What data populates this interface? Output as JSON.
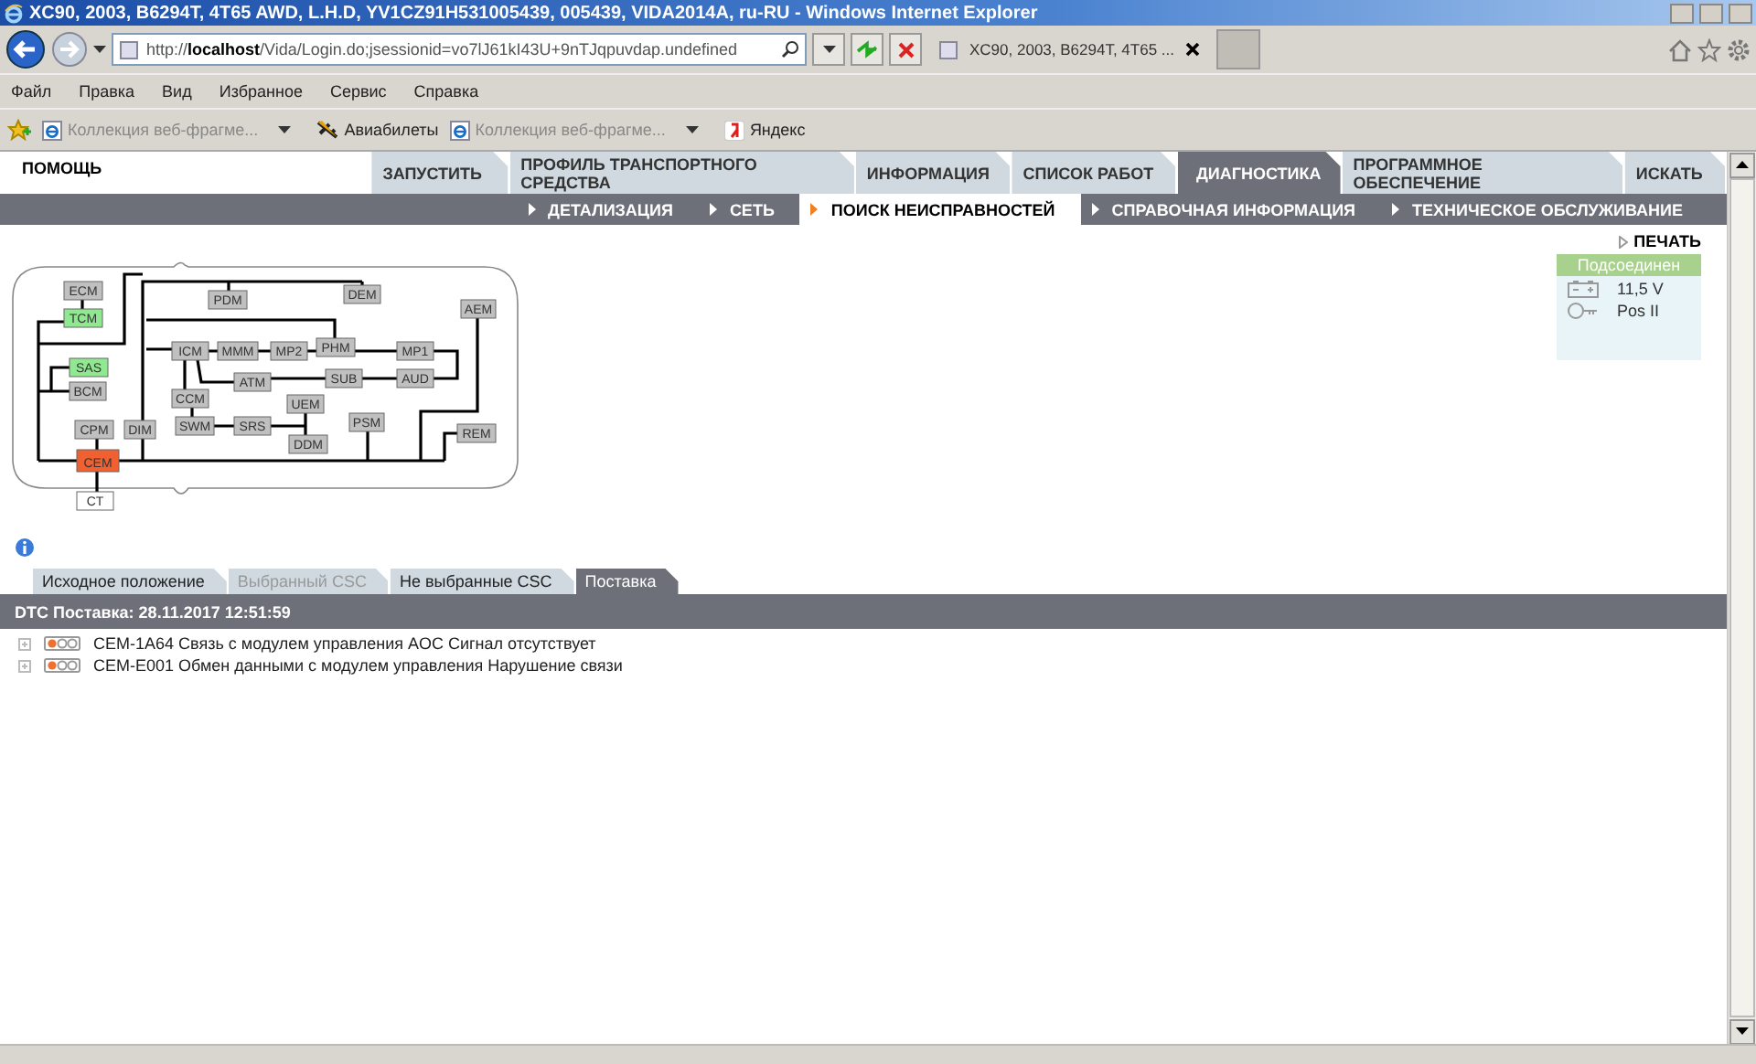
{
  "window": {
    "title": "XC90, 2003, B6294T, 4T65 AWD, L.H.D, YV1CZ91H531005439, 005439, VIDA2014A, ru-RU - Windows Internet Explorer"
  },
  "address_bar": {
    "url": "http://**localhost**/Vida/Login.do;jsessionid=vo7lJ61kI43U+9nTJqpuvdap.undefined"
  },
  "browser_tabs": [
    {
      "label": "XC90, 2003, B6294T, 4T65 ...",
      "selected": true
    }
  ],
  "menu": [
    "Файл",
    "Правка",
    "Вид",
    "Избранное",
    "Сервис",
    "Справка"
  ],
  "favorites": [
    {
      "label": "Коллекция веб-фрагме...",
      "kind": "gallery"
    },
    {
      "label": "Авиабилеты",
      "kind": "flight"
    },
    {
      "label": "Коллекция веб-фрагме...",
      "kind": "gallery"
    },
    {
      "label": "Яндекс",
      "kind": "yandex"
    }
  ],
  "app": {
    "help": "ПОМОЩЬ",
    "main_tabs": [
      {
        "label": "ЗАПУСТИТЬ",
        "selected": false
      },
      {
        "label": "ПРОФИЛЬ ТРАНСПОРТНОГО СРЕДСТВА",
        "selected": false
      },
      {
        "label": "ИНФОРМАЦИЯ",
        "selected": false
      },
      {
        "label": "СПИСОК РАБОТ",
        "selected": false
      },
      {
        "label": "ДИАГНОСТИКА",
        "selected": true
      },
      {
        "label": "ПРОГРАММНОЕ ОБЕСПЕЧЕНИЕ",
        "selected": false
      },
      {
        "label": "ИСКАТЬ",
        "selected": false
      }
    ],
    "sub_tabs": [
      {
        "label": "ДЕТАЛИЗАЦИЯ",
        "selected": false
      },
      {
        "label": "СЕТЬ",
        "selected": false
      },
      {
        "label": "ПОИСК НЕИСПРАВНОСТЕЙ",
        "selected": true
      },
      {
        "label": "СПРАВОЧНАЯ ИНФОРМАЦИЯ",
        "selected": false
      },
      {
        "label": "ТЕХНИЧЕСКОЕ ОБСЛУЖИВАНИЕ",
        "selected": false
      }
    ],
    "print": "ПЕЧАТЬ",
    "network": {
      "nodes": [
        {
          "label": "ECM",
          "color": "#c0c0c0"
        },
        {
          "label": "TCM",
          "color": "#90e890"
        },
        {
          "label": "SAS",
          "color": "#90e890"
        },
        {
          "label": "BCM",
          "color": "#c0c0c0"
        },
        {
          "label": "CPM",
          "color": "#c0c0c0"
        },
        {
          "label": "CEM",
          "color": "#f06030"
        },
        {
          "label": "CT",
          "color": "#ffffff"
        },
        {
          "label": "DIM",
          "color": "#c0c0c0"
        },
        {
          "label": "PDM",
          "color": "#c0c0c0"
        },
        {
          "label": "DEM",
          "color": "#c0c0c0"
        },
        {
          "label": "AEM",
          "color": "#c0c0c0"
        },
        {
          "label": "ICM",
          "color": "#c0c0c0"
        },
        {
          "label": "MMM",
          "color": "#c0c0c0"
        },
        {
          "label": "MP2",
          "color": "#c0c0c0"
        },
        {
          "label": "PHM",
          "color": "#c0c0c0"
        },
        {
          "label": "MP1",
          "color": "#c0c0c0"
        },
        {
          "label": "ATM",
          "color": "#c0c0c0"
        },
        {
          "label": "SUB",
          "color": "#c0c0c0"
        },
        {
          "label": "AUD",
          "color": "#c0c0c0"
        },
        {
          "label": "CCM",
          "color": "#c0c0c0"
        },
        {
          "label": "UEM",
          "color": "#c0c0c0"
        },
        {
          "label": "SWM",
          "color": "#c0c0c0"
        },
        {
          "label": "SRS",
          "color": "#c0c0c0"
        },
        {
          "label": "DDM",
          "color": "#c0c0c0"
        },
        {
          "label": "PSM",
          "color": "#c0c0c0"
        },
        {
          "label": "REM",
          "color": "#c0c0c0"
        }
      ]
    },
    "status": {
      "title": "Подсоединен",
      "voltage": "11,5 V",
      "ignition": "Pos II"
    },
    "dtc_tabs": [
      {
        "label": "Исходное положение",
        "selected": false,
        "disabled": false
      },
      {
        "label": "Выбранный CSC",
        "selected": false,
        "disabled": true
      },
      {
        "label": "Не выбранные CSC",
        "selected": false,
        "disabled": false
      },
      {
        "label": "Поставка",
        "selected": true,
        "disabled": false
      }
    ],
    "dtc_header": "DTC Поставка: 28.11.2017 12:51:59",
    "dtcs": [
      {
        "text": "CEM-1A64 Связь с модулем управления AOC Сигнал отсутствует"
      },
      {
        "text": "CEM-E001 Обмен данными с модулем управления Нарушение связи"
      }
    ]
  }
}
